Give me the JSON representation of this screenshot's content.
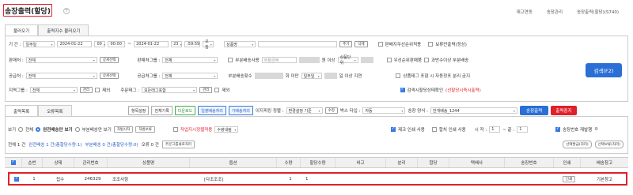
{
  "page_title": "송장출력(할당)",
  "breadcrumb": [
    "재고연동",
    "송장관리",
    "송장출력(할당)(S740)"
  ],
  "tabs": [
    "불러오기",
    "출력지수 불러오기"
  ],
  "filters": {
    "period_label": "기 간 :",
    "period_select": "일주일",
    "date_from": "2024-01-22",
    "hour_from": "00",
    "min_from": "00:00",
    "date_to": "2024-01-22",
    "hour_to": "23",
    "min_to": ":59:59",
    "today": "오늘",
    "product_select": "상품명",
    "add_btn": "추가",
    "del_btn": "삭제",
    "chk_split": "판배지우선순위적용",
    "chk_hold": "보류만출력(정상)",
    "seller_label": "판매처 :",
    "seller_value": "전체",
    "seller_detail_btn": "상세선택",
    "seller_group_label": "판매처그룹 :",
    "seller_group_value": "전체",
    "partial_use": "부분배송사용",
    "partial_amount_placeholder": "부분금액",
    "won_or_more": "원 이상",
    "product_unit": "상품단위",
    "chk_priority_stock": "우선순위판매품",
    "chk_over_qty": "과반수이상 부분배송",
    "supplier_label": "공급처 :",
    "supplier_value": "전체",
    "supplier_detail_btn": "상세선택",
    "supplier_group_label": "공급처그룹 :",
    "supplier_group_value": "전체",
    "partial_count": "부분배송횟수",
    "times_under": "회 미만",
    "week": "일주일",
    "days_delay": "일 이상 지연",
    "chk_tag_include": "상품태그 포함 시 자동정포 분리 금지",
    "region_label": "지역그룹 :",
    "region_value": "전체",
    "manage_btn": "관리",
    "exclude": "제외",
    "order_tag_label": "주문태그 :",
    "order_tag_value": "모든태그포함",
    "manage_btn2": "관리",
    "exclude2": "제외",
    "chk_search_status": "검색시할당상태확인",
    "chk_search_status_note": "(선할당시즉시출력)",
    "search_btn": "검색(F2)"
  },
  "sub_tabs": [
    "출력목록",
    "오류목록"
  ],
  "toolbar": {
    "buttons": [
      "항목설정",
      "전체기록",
      "다운로드",
      "일괄배송처리",
      "가배송처리"
    ],
    "image_label": "이지피킹 정렬 :",
    "image_value": "환경설정 기준",
    "modify_btn": "수정",
    "box_type_label": "박스 타입 :",
    "box_type_value": "자동",
    "invoice_mode_label": "송장 양식 :",
    "invoice_mode_value": "한개배송_1244",
    "print_btn": "송장출력",
    "stop_btn": "출력중지"
  },
  "view": {
    "label": "보기",
    "options": [
      "전체",
      "완전배송만 보기",
      "부분배송만 보기"
    ],
    "split_btn": "처법시작",
    "reset_btn": "처법보류",
    "chk_auto_print": "작업지시정렬적용",
    "sort_value": "수량내림",
    "chk_chk_addr": "제크 인쇄 사용",
    "chk_fold": "합치 인쇄 사용",
    "start_label": "시 작 :",
    "start_value": "1",
    "dash": "~ 끝 :",
    "end_value": "1",
    "chk_reprint": "송장번호 재발행",
    "gear": "⚙"
  },
  "summary": {
    "total": "전체 1 건",
    "full": "완전배송 1 건(총할당수량:1)",
    "partial": "부분배송 0 건(총할당수량:0)",
    "error": "오류 0 건",
    "recheck_btn": "주문그룹새로처리",
    "sel_apply": "선택발급(처리)",
    "sel_all": "선택보류(처리)"
  },
  "table": {
    "headers": [
      "순번",
      "상태",
      "관리번호",
      "상품명",
      "옵션",
      "수량",
      "할당수량",
      "비고",
      "분리",
      "합당",
      "택배사",
      "송장번호",
      "인쇄",
      "배송창고"
    ],
    "rows": [
      {
        "seq": "1",
        "status": "접수",
        "code": "246329",
        "product": "조조사항",
        "option": "[다조조조]",
        "qty": "1",
        "alloc": "1",
        "note": "",
        "split": "",
        "merge": "",
        "courier": "",
        "invoice": "",
        "print": "인쇄",
        "warehouse": "기본창고"
      }
    ]
  }
}
